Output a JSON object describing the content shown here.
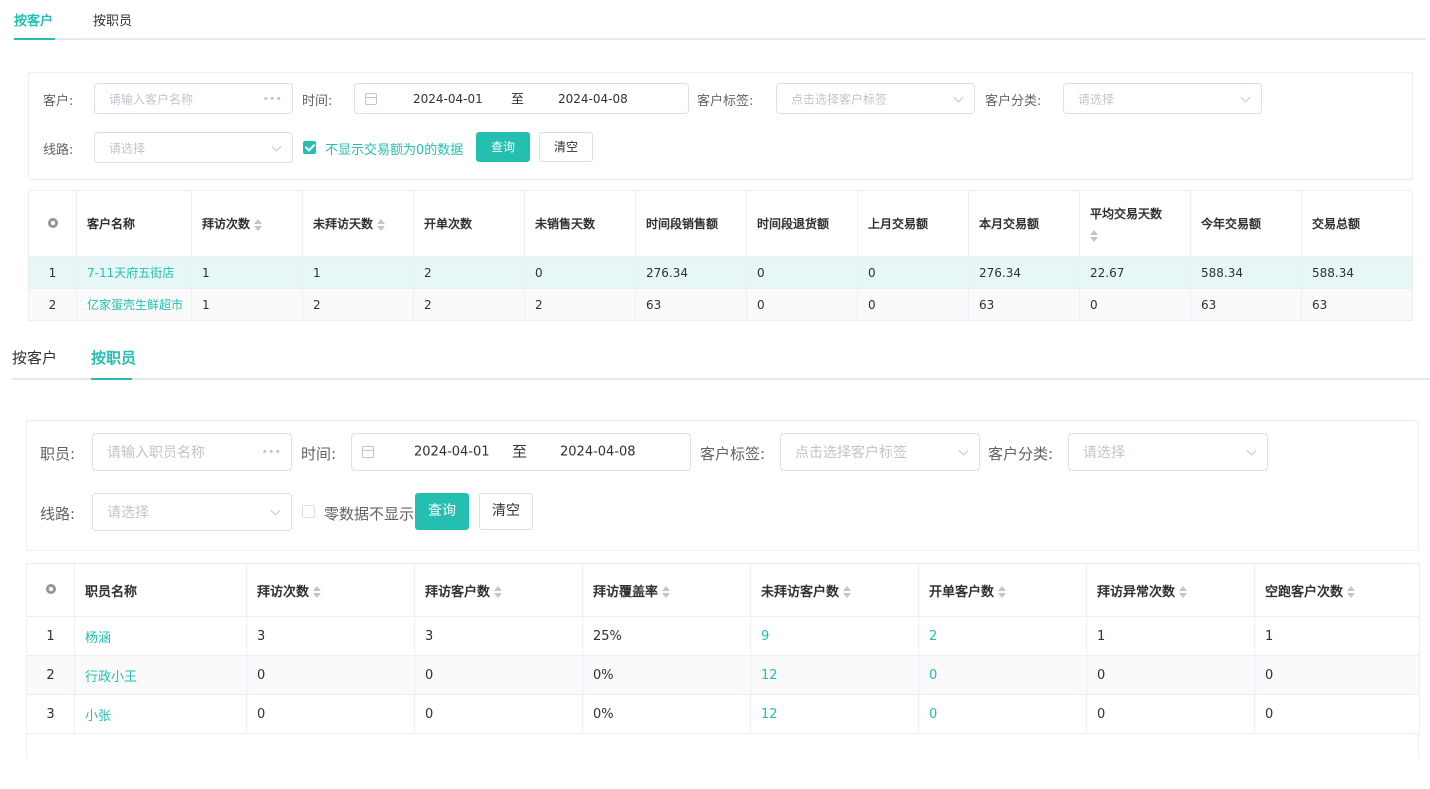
{
  "panel1": {
    "tabs": [
      {
        "label": "按客户",
        "active": true
      },
      {
        "label": "按职员",
        "active": false
      }
    ],
    "filters": {
      "customer_label": "客户:",
      "customer_placeholder": "请输入客户名称",
      "time_label": "时间:",
      "date_from": "2024-04-01",
      "date_sep": "至",
      "date_to": "2024-04-08",
      "tag_label": "客户标签:",
      "tag_placeholder": "点击选择客户标签",
      "category_label": "客户分类:",
      "category_placeholder": "请选择",
      "route_label": "线路:",
      "route_placeholder": "请选择",
      "checkbox_label": "不显示交易额为0的数据",
      "checkbox_checked": true,
      "query_label": "查询",
      "clear_label": "清空"
    },
    "table": {
      "headers": [
        "客户名称",
        "拜访次数",
        "未拜访天数",
        "开单次数",
        "未销售天数",
        "时间段销售额",
        "时间段退货额",
        "上月交易额",
        "本月交易额",
        "平均交易天数",
        "今年交易额",
        "交易总额"
      ],
      "rows": [
        {
          "index": "1",
          "cells": [
            "7-11天府五街店",
            "1",
            "1",
            "2",
            "0",
            "276.34",
            "0",
            "0",
            "276.34",
            "22.67",
            "588.34",
            "588.34"
          ]
        },
        {
          "index": "2",
          "cells": [
            "亿家蛋壳生鲜超市",
            "1",
            "2",
            "2",
            "2",
            "63",
            "0",
            "0",
            "63",
            "0",
            "63",
            "63"
          ]
        }
      ]
    }
  },
  "panel2": {
    "tabs": [
      {
        "label": "按客户",
        "active": false
      },
      {
        "label": "按职员",
        "active": true
      }
    ],
    "filters": {
      "staff_label": "职员:",
      "staff_placeholder": "请输入职员名称",
      "time_label": "时间:",
      "date_from": "2024-04-01",
      "date_sep": "至",
      "date_to": "2024-04-08",
      "tag_label": "客户标签:",
      "tag_placeholder": "点击选择客户标签",
      "category_label": "客户分类:",
      "category_placeholder": "请选择",
      "route_label": "线路:",
      "route_placeholder": "请选择",
      "checkbox_label": "零数据不显示",
      "checkbox_checked": false,
      "query_label": "查询",
      "clear_label": "清空"
    },
    "table": {
      "headers": [
        "职员名称",
        "拜访次数",
        "拜访客户数",
        "拜访覆盖率",
        "未拜访客户数",
        "开单客户数",
        "拜访异常次数",
        "空跑客户次数"
      ],
      "rows": [
        {
          "index": "1",
          "cells": [
            "杨涵",
            "3",
            "3",
            "25%",
            "9",
            "2",
            "1",
            "1"
          ]
        },
        {
          "index": "2",
          "cells": [
            "行政小王",
            "0",
            "0",
            "0%",
            "12",
            "0",
            "0",
            "0"
          ]
        },
        {
          "index": "3",
          "cells": [
            "小张",
            "0",
            "0",
            "0%",
            "12",
            "0",
            "0",
            "0"
          ]
        }
      ]
    }
  },
  "icons": {
    "more": "ellipsis-icon",
    "calendar": "calendar-icon",
    "select": "chevron-down-icon",
    "sort": "sort-caret-icon",
    "settings": "gear-icon"
  },
  "colors": {
    "accent": "#24bfb1",
    "highlight_row": "#e6f7f6",
    "border": "#ebeef5"
  }
}
